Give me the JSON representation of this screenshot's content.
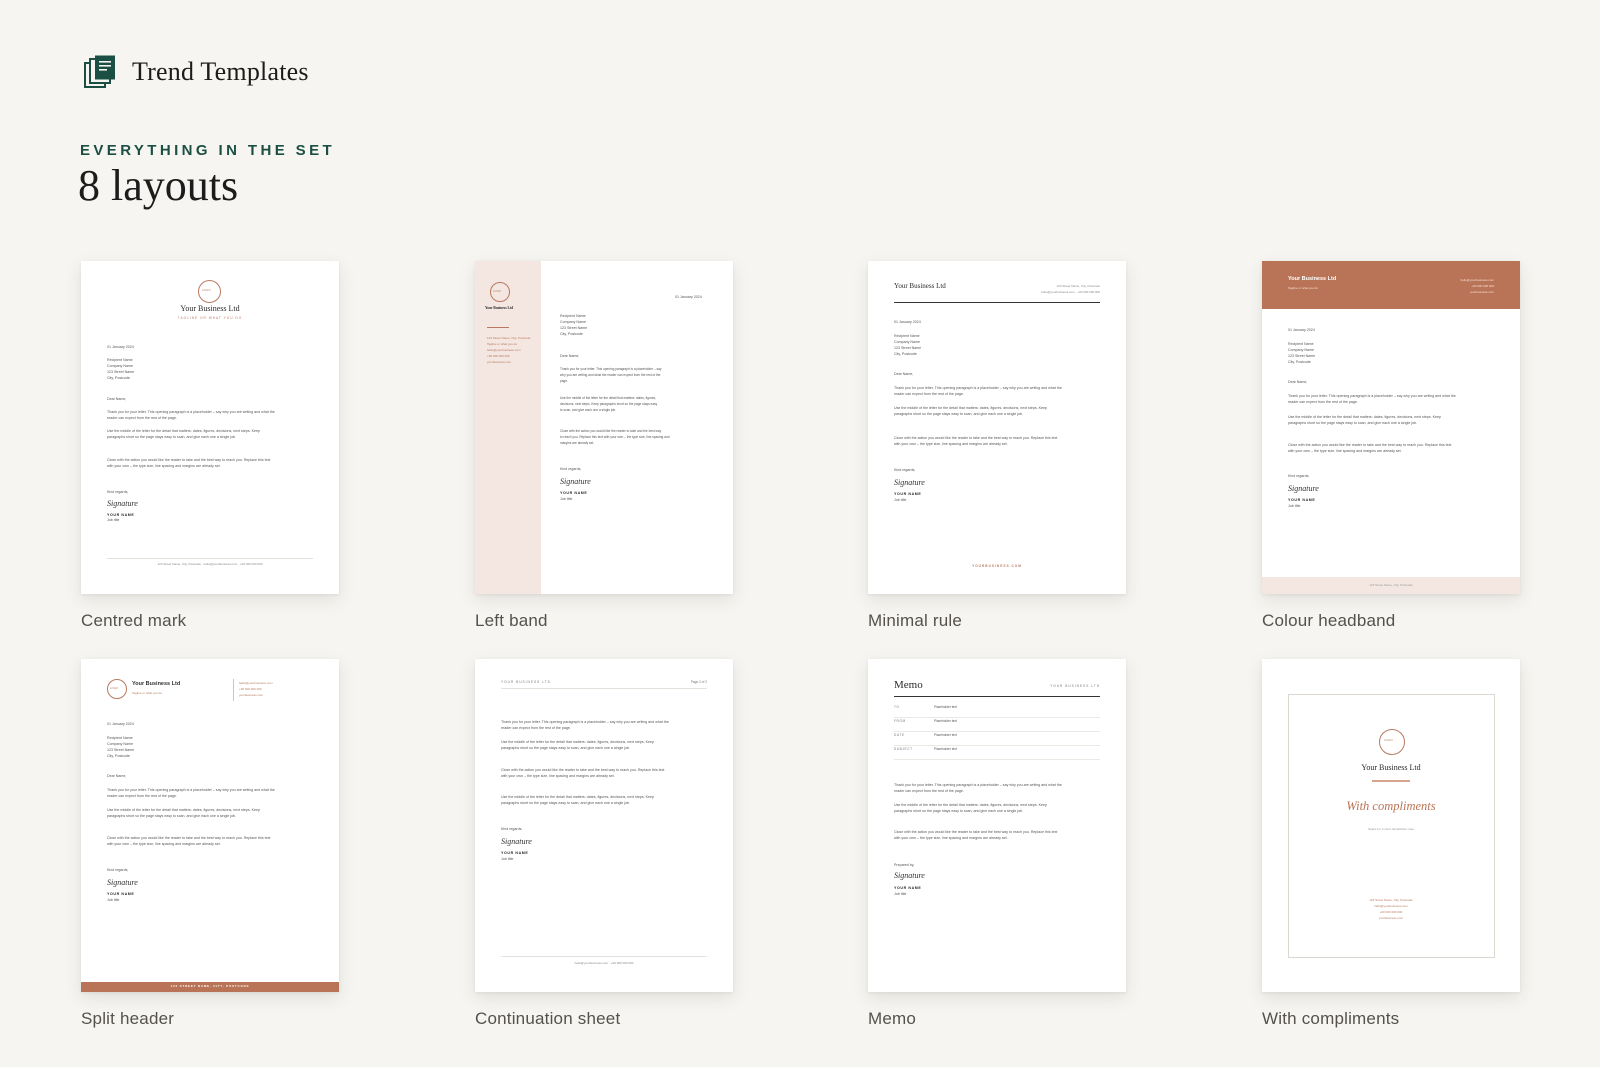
{
  "brand": {
    "name": "Trend Templates",
    "icon": "stacked-documents-icon",
    "accent": "#1c4f43"
  },
  "section": {
    "eyebrow": "EVERYTHING IN THE SET",
    "title": "8 layouts"
  },
  "colors": {
    "background": "#f6f5f1",
    "terracotta": "#b97356",
    "blush": "#f4e6e0",
    "green": "#1c4f43"
  },
  "layouts": [
    {
      "name": "Centred mark"
    },
    {
      "name": "Left band"
    },
    {
      "name": "Minimal rule"
    },
    {
      "name": "Colour headband"
    },
    {
      "name": "Split header"
    },
    {
      "name": "Continuation sheet"
    },
    {
      "name": "Memo"
    },
    {
      "name": "With compliments"
    }
  ],
  "sample": {
    "company": "Your Business Ltd",
    "tagline": "TAGLINE OR WHAT YOU DO",
    "tagline_short": "Tagline or what you do",
    "logo": "LOGO",
    "date": "01 January 2024",
    "recipient": [
      "Recipient Name",
      "Company Name",
      "123 Street Name",
      "City, Postcode"
    ],
    "greeting": "Dear Name,",
    "para1": [
      "Thank you for your letter. This opening paragraph is a placeholder – say why you are writing and what the",
      "reader can expect from the rest of the page."
    ],
    "para2": [
      "Use the middle of the letter for the detail that matters: dates, figures, decisions, next steps. Keep",
      "paragraphs short so the page stays easy to scan, and give each one a single job."
    ],
    "para3": [
      "Close with the action you would like the reader to take and the best way to reach you. Replace this text",
      "with your own – the type size, line spacing and margins are already set."
    ],
    "closing": "Kind regards,",
    "signature": "Signature",
    "your_name": "YOUR NAME",
    "job_title": "Job title",
    "footer": "123 Street Name, City, Postcode · hello@yourbusiness.com · +00 000 000 000",
    "address": "123 Street Name, City, Postcode",
    "email": "hello@yourbusiness.com",
    "phone": "+00 000 000 000",
    "website": "yourbusiness.com",
    "website_caps": "YOURBUSINESS.COM",
    "footer_caps": "123 STREET NAME, CITY, POSTCODE",
    "continuation_header": "YOUR BUSINESS LTD",
    "page": "Page 2 of 2",
    "continuation_footer": "hello@yourbusiness.com · +00 000 000 000",
    "memo_title": "Memo",
    "memo_fields": [
      {
        "label": "TO",
        "value": "Placeholder text"
      },
      {
        "label": "FROM",
        "value": "Placeholder text"
      },
      {
        "label": "DATE",
        "value": "Placeholder text"
      },
      {
        "label": "SUBJECT",
        "value": "Placeholder text"
      }
    ],
    "prepared_by": "Prepared by,",
    "compliments": "With compliments",
    "compliments_note": "Space for a short handwritten note"
  }
}
